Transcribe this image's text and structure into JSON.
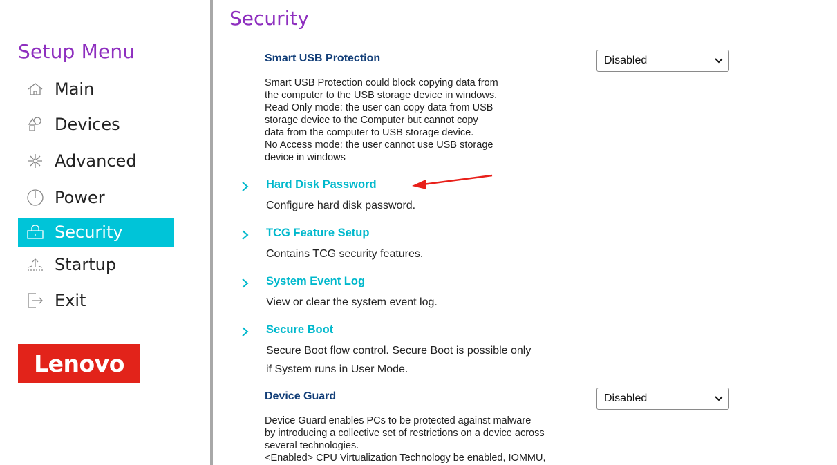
{
  "sidebar": {
    "title": "Setup Menu",
    "items": [
      {
        "label": "Main",
        "icon": "home-icon",
        "active": false
      },
      {
        "label": "Devices",
        "icon": "shapes-icon",
        "active": false
      },
      {
        "label": "Advanced",
        "icon": "sparkle-icon",
        "active": false
      },
      {
        "label": "Power",
        "icon": "clock-icon",
        "active": false
      },
      {
        "label": "Security",
        "icon": "lock-icon",
        "active": true
      },
      {
        "label": "Startup",
        "icon": "startup-icon",
        "active": false
      },
      {
        "label": "Exit",
        "icon": "exit-icon",
        "active": false
      }
    ],
    "logo_text": "Lenovo"
  },
  "colors": {
    "accent_purple": "#8e2fbf",
    "active_cyan": "#00c4d8",
    "link_cyan": "#00b8cc",
    "label_navy": "#123e78",
    "logo_red": "#e2231a",
    "annotation_red": "#e8201a"
  },
  "main": {
    "title": "Security",
    "smart_usb": {
      "label": "Smart USB Protection",
      "value": "Disabled",
      "description": "Smart USB Protection could block copying data from\nthe computer to the USB storage device in windows.\nRead Only mode: the user can copy data from USB\nstorage device to the Computer but cannot copy\ndata from the computer to USB storage device.\nNo Access mode: the user cannot use USB storage\ndevice in windows"
    },
    "submenus": [
      {
        "title": "Hard Disk Password",
        "description": "Configure hard disk password."
      },
      {
        "title": "TCG Feature Setup",
        "description": "Contains TCG security features."
      },
      {
        "title": "System Event Log",
        "description": "View or clear the system event log."
      },
      {
        "title": "Secure Boot",
        "description": "Secure Boot flow control. Secure Boot is possible only\nif System runs in User Mode."
      }
    ],
    "device_guard": {
      "label": "Device Guard",
      "value": "Disabled",
      "description": "Device Guard enables PCs to be protected against malware\nby introducing a collective set of restrictions on a device across\nseveral technologies.\n<Enabled> CPU Virtualization Technology be enabled, IOMMU,"
    }
  }
}
